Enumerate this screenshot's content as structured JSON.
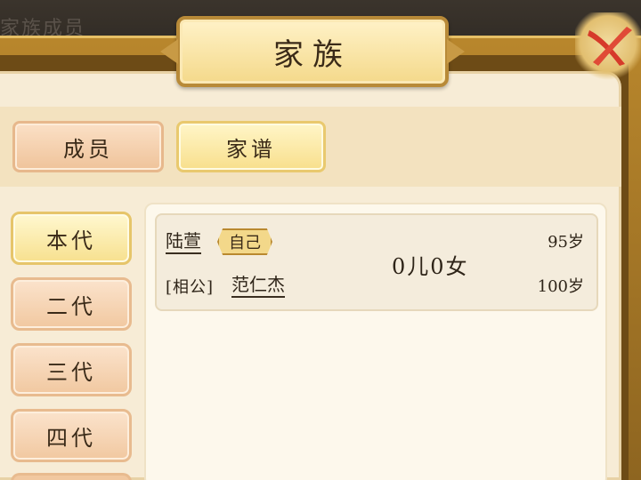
{
  "header": {
    "title": "家族",
    "backdrop_text": "家族成员"
  },
  "tabs": [
    {
      "label": "成员"
    },
    {
      "label": "家谱"
    }
  ],
  "generations": [
    {
      "label": "本代"
    },
    {
      "label": "二代"
    },
    {
      "label": "三代"
    },
    {
      "label": "四代"
    }
  ],
  "family_card": {
    "self_name": "陆萱",
    "self_badge": "自己",
    "self_age": "95岁",
    "spouse_relation": "[相公]",
    "spouse_name": "范仁杰",
    "spouse_age": "100岁",
    "children": "0儿0女"
  }
}
